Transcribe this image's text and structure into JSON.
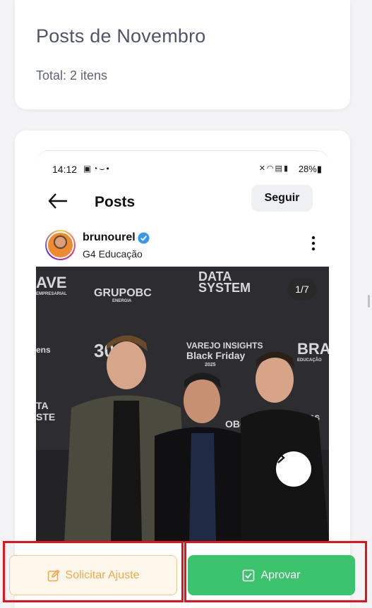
{
  "summary": {
    "title": "Posts de Novembro",
    "total": "Total: 2 itens"
  },
  "post": {
    "status_bar": {
      "time": "14:12",
      "battery": "28%",
      "left_icons": [
        "image-icon",
        "whatsapp-icon",
        "chevron-icon",
        "dot-icon"
      ],
      "right_icons": [
        "mute-icon",
        "wifi-icon",
        "volte-icon",
        "signal-icon"
      ]
    },
    "header": {
      "title": "Posts",
      "follow_label": "Seguir"
    },
    "author": {
      "username": "brunourel",
      "subtitle": "G4 Educação",
      "verified": true
    },
    "media": {
      "counter": "1/7",
      "backdrop_texts": [
        "AVE",
        "EMPRESARIAL",
        "GRUPOBC",
        "ENERGIA",
        "DATA",
        "SYSTEM",
        "30",
        "VAREJO INSIGHTS",
        "Black Friday",
        "2025",
        "BRA",
        "EDUCAÇÃO",
        "TA",
        "STE",
        "OBC",
        "ens",
        "ens"
      ]
    }
  },
  "actions": {
    "adjust_label": "Solicitar Ajuste",
    "approve_label": "Aprovar"
  },
  "colors": {
    "approve": "#3cc36d",
    "adjust_bg": "#fef7ec",
    "adjust_text": "#f3a84a",
    "highlight": "#e2141b",
    "verified": "#3797f0"
  }
}
